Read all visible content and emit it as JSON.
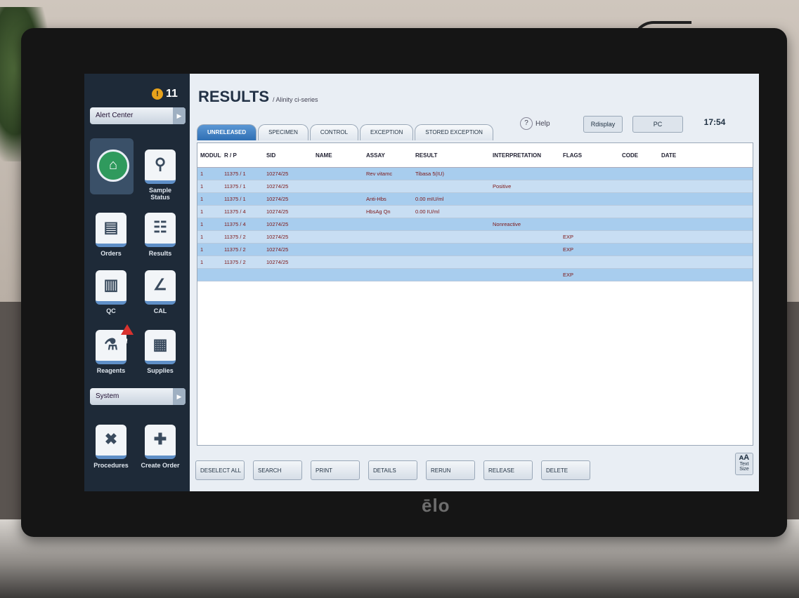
{
  "brand": "ēlo",
  "alert_count": "11",
  "alert_center_label": "Alert Center",
  "system_label": "System",
  "nav": {
    "sample_status": "Sample Status",
    "orders": "Orders",
    "results": "Results",
    "qc": "QC",
    "cal": "CAL",
    "reagents": "Reagents",
    "supplies": "Supplies",
    "procedures": "Procedures",
    "create_order": "Create Order"
  },
  "page": {
    "title": "RESULTS",
    "subtitle": "/ Alinity ci-series",
    "help_label": "?",
    "help_text": "Help",
    "header_buttons": [
      "Rdisplay",
      "PC"
    ],
    "clock_time": "17:54"
  },
  "tabs": [
    "UNRELEASED",
    "SPECIMEN",
    "CONTROL",
    "EXCEPTION",
    "STORED EXCEPTION"
  ],
  "columns": [
    "MODULE ID",
    "R / P",
    "SID",
    "NAME",
    "ASSAY",
    "RESULT",
    "INTERPRETATION",
    "FLAGS",
    "CODE",
    "DATE"
  ],
  "rows": [
    [
      "1",
      "11375 / 1",
      "10274/25",
      "",
      "Rev vitamc",
      "Tibasa 5(IU)",
      "",
      "",
      "",
      ""
    ],
    [
      "1",
      "11375 / 1",
      "10274/25",
      "",
      "",
      "",
      "Positive",
      "",
      "",
      ""
    ],
    [
      "1",
      "11375 / 1",
      "10274/25",
      "",
      "Anti-Hbs",
      "0.00 mIU/ml",
      "",
      "",
      "",
      ""
    ],
    [
      "1",
      "11375 / 4",
      "10274/25",
      "",
      "HbsAg Qn",
      "0.00 IU/ml",
      "",
      "",
      "",
      ""
    ],
    [
      "1",
      "11375 / 4",
      "10274/25",
      "",
      "",
      "",
      "Nonreactive",
      "",
      "",
      ""
    ],
    [
      "1",
      "11375 / 2",
      "10274/25",
      "",
      "",
      "",
      "",
      "EXP",
      "",
      ""
    ],
    [
      "1",
      "11375 / 2",
      "10274/25",
      "",
      "",
      "",
      "",
      "EXP",
      "",
      ""
    ],
    [
      "1",
      "11375 / 2",
      "10274/25",
      "",
      "",
      "",
      "",
      "",
      "",
      ""
    ],
    [
      "",
      "",
      "",
      "",
      "",
      "",
      "",
      "EXP",
      "",
      ""
    ]
  ],
  "footer_buttons": [
    "DESELECT ALL",
    "SEARCH",
    "PRINT",
    "DETAILS",
    "RERUN",
    "RELEASE",
    "DELETE"
  ],
  "text_size_label": "Text Size"
}
